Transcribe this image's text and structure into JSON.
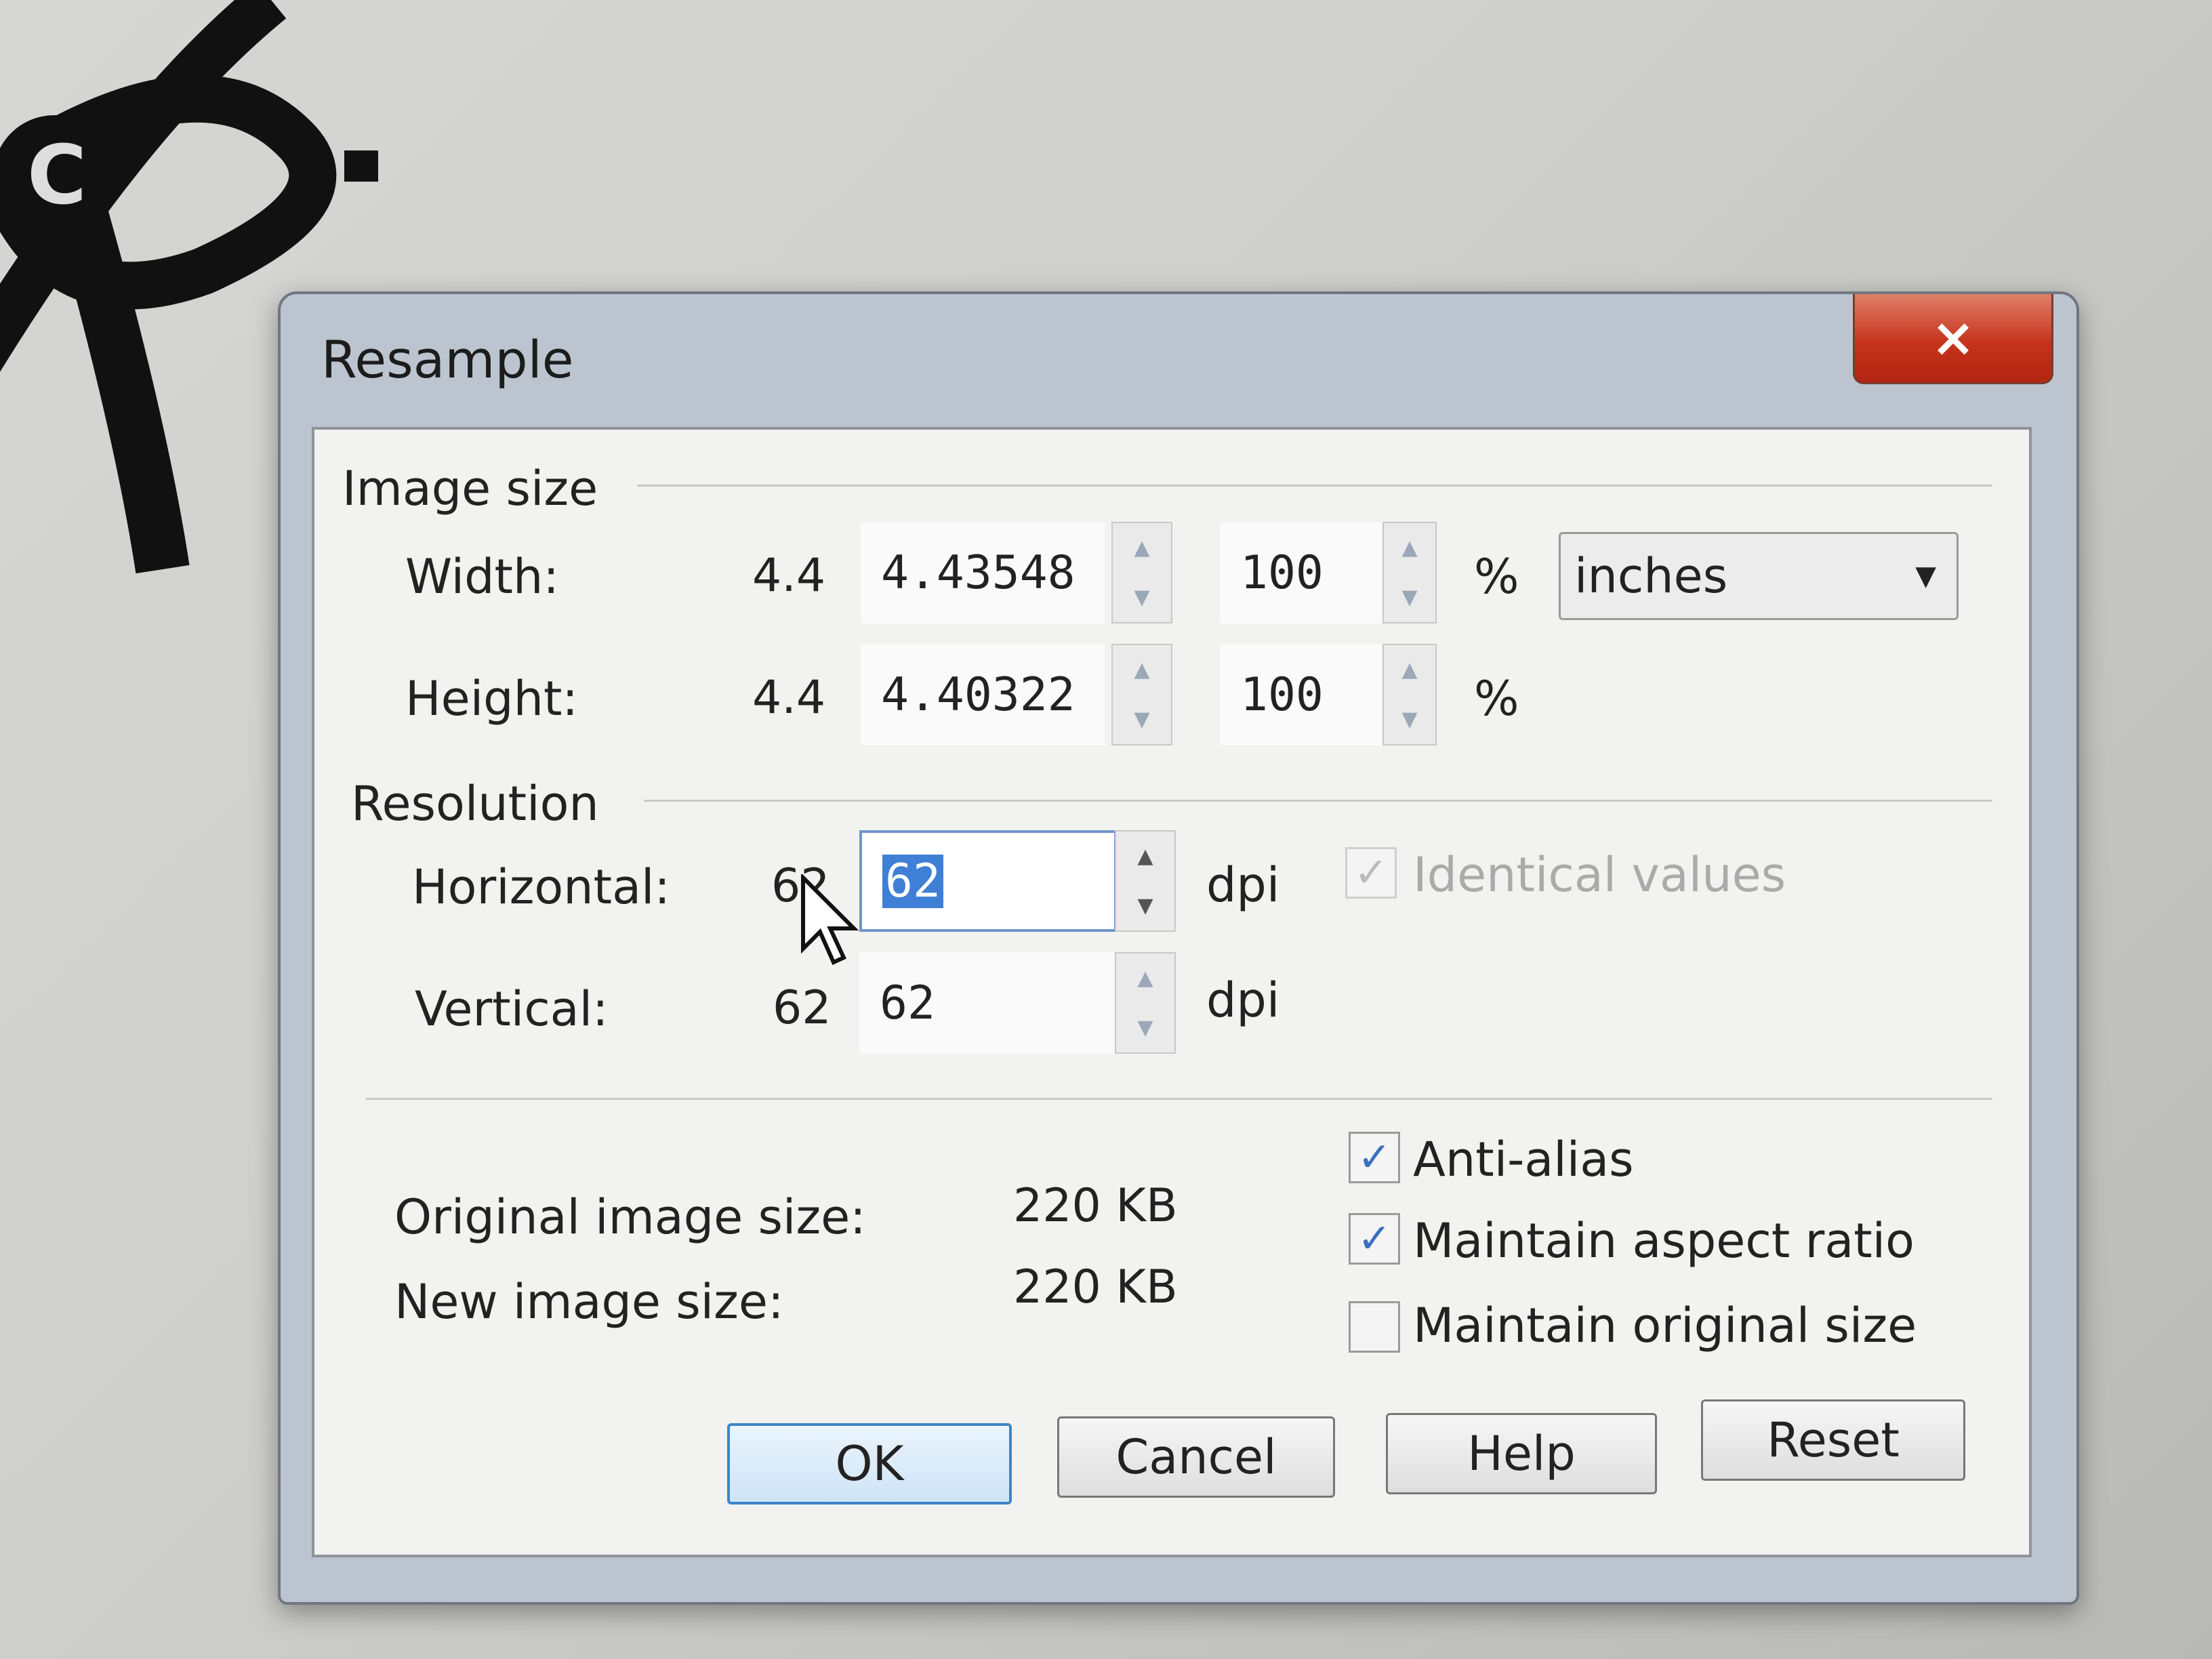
{
  "window": {
    "title": "Resample",
    "close_label": "×"
  },
  "image_size": {
    "heading": "Image size",
    "width": {
      "label": "Width:",
      "current": "4.4",
      "value": "4.43548",
      "percent": "100",
      "percent_unit": "%"
    },
    "height": {
      "label": "Height:",
      "current": "4.4",
      "value": "4.40322",
      "percent": "100",
      "percent_unit": "%"
    },
    "units": {
      "selected": "inches"
    }
  },
  "resolution": {
    "heading": "Resolution",
    "horizontal": {
      "label": "Horizontal:",
      "current": "62",
      "value": "62",
      "unit": "dpi"
    },
    "vertical": {
      "label": "Vertical:",
      "current": "62",
      "value": "62",
      "unit": "dpi"
    },
    "identical_values": {
      "label": "Identical values",
      "checked": true,
      "enabled": false
    }
  },
  "info": {
    "original_label": "Original image size:",
    "original_value": "220 KB",
    "new_label": "New image size:",
    "new_value": "220 KB"
  },
  "options": {
    "anti_alias": {
      "label": "Anti-alias",
      "checked": true
    },
    "maintain_aspect": {
      "label": "Maintain aspect ratio",
      "checked": true
    },
    "maintain_original": {
      "label": "Maintain original size",
      "checked": false
    }
  },
  "buttons": {
    "ok": "OK",
    "cancel": "Cancel",
    "help": "Help",
    "reset": "Reset"
  },
  "colors": {
    "close": "#c6331c",
    "selection": "#3f7fd6",
    "default_button_border": "#3d84c9"
  }
}
